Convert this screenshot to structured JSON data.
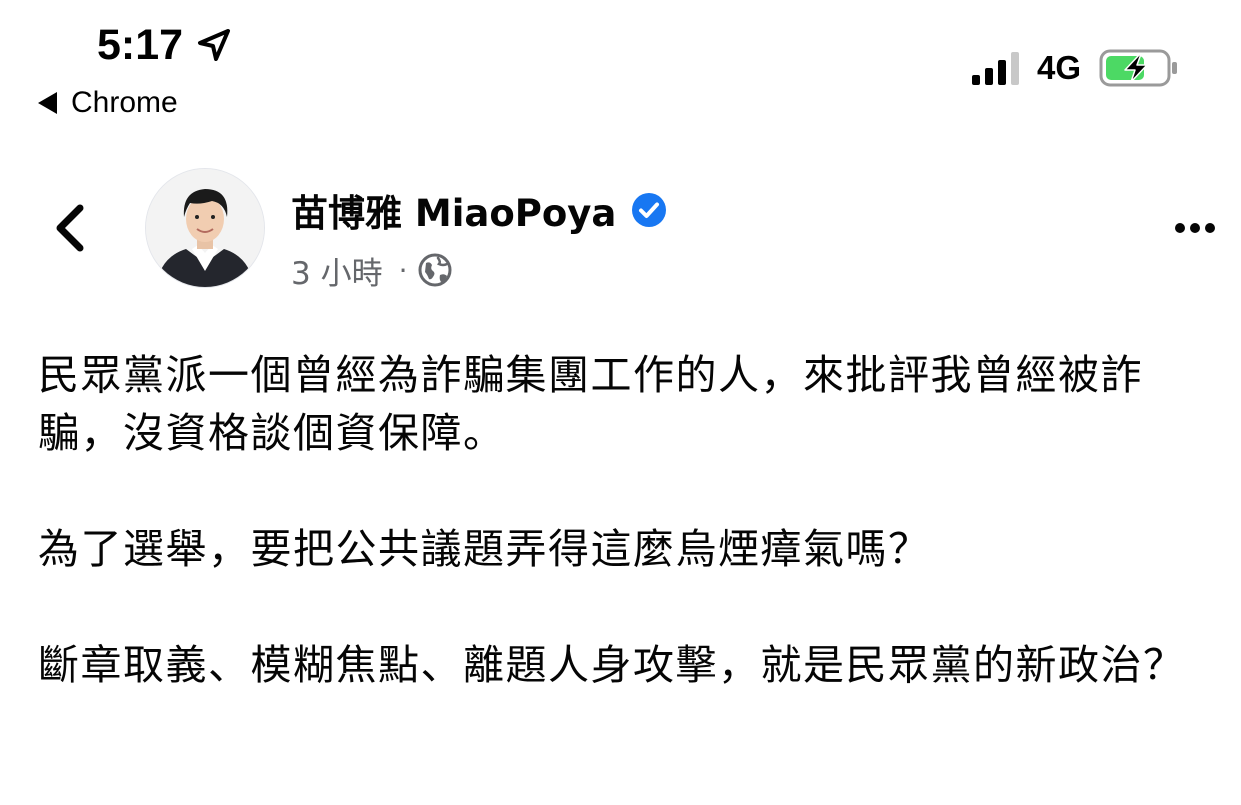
{
  "status_bar": {
    "time": "5:17",
    "back_app": "Chrome",
    "network": "4G",
    "signal_bars_active": 3,
    "signal_bars_total": 4,
    "battery_level": 0.65,
    "charging": true,
    "icons": [
      "location-arrow-icon",
      "back-triangle-icon",
      "signal-icon",
      "battery-charging-icon"
    ]
  },
  "post": {
    "author": "苗博雅 MiaoPoya",
    "verified": true,
    "time_ago": "3 小時",
    "separator": "·",
    "audience_icon": "globe-icon",
    "header_icons": [
      "chevron-left-icon",
      "more-icon",
      "verified-badge-icon"
    ],
    "paragraphs": [
      "民眾黨派一個曾經為詐騙集團工作的人，來批評我曾經被詐騙，沒資格談個資保障。",
      "為了選舉，要把公共議題弄得這麼烏煙瘴氣嗎？",
      "斷章取義、模糊焦點、離題人身攻擊，就是民眾黨的新政治？"
    ]
  },
  "colors": {
    "text_primary": "#050505",
    "text_secondary": "#65676b",
    "verified_blue": "#1877f2",
    "battery_green": "#4cd964"
  }
}
